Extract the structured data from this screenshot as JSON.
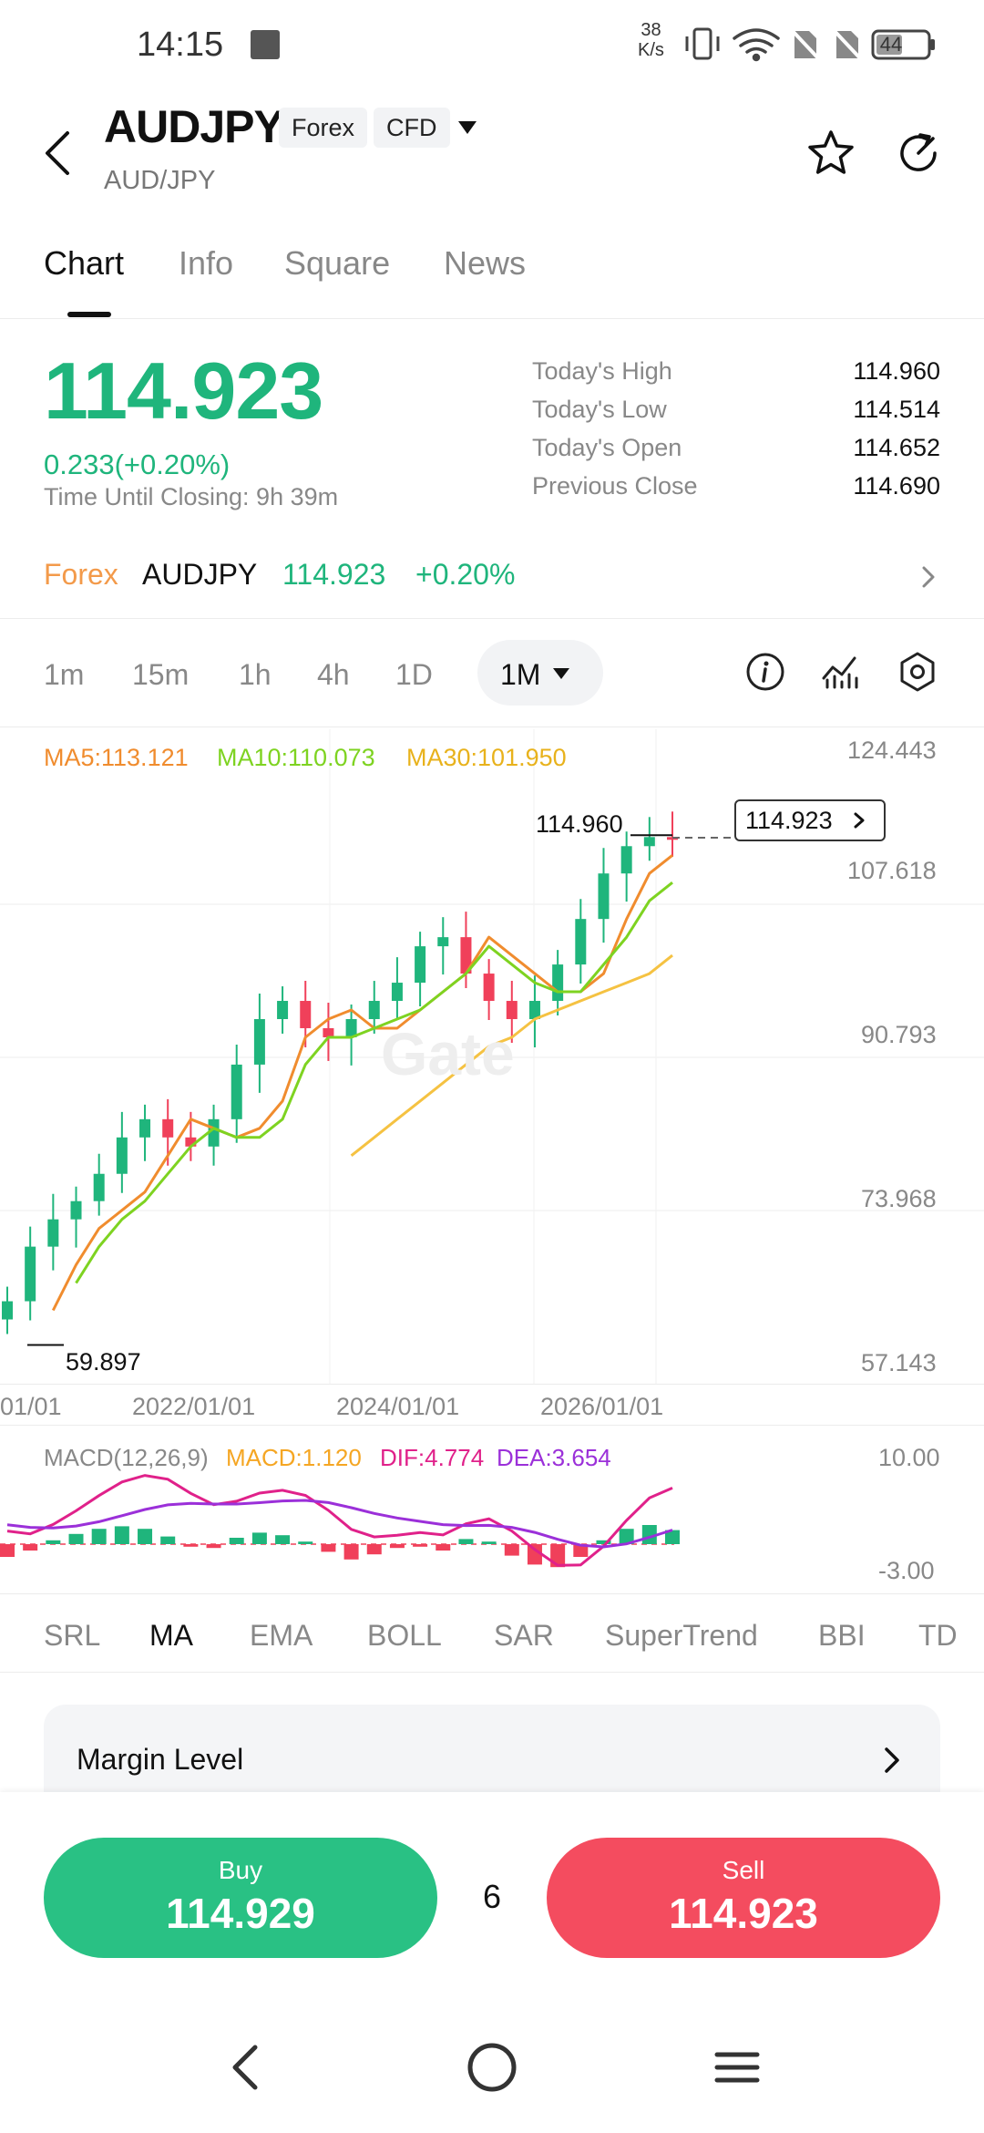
{
  "status_bar": {
    "time": "14:15",
    "net_speed_value": "38",
    "net_speed_unit": "K/s",
    "battery": "44"
  },
  "header": {
    "title": "AUDJPY",
    "tags": [
      "Forex",
      "CFD"
    ],
    "subtitle": "AUD/JPY"
  },
  "tabs": [
    {
      "label": "Chart",
      "active": true
    },
    {
      "label": "Info",
      "active": false
    },
    {
      "label": "Square",
      "active": false
    },
    {
      "label": "News",
      "active": false
    }
  ],
  "quote": {
    "price": "114.923",
    "change": "0.233(+0.20%)",
    "closing_text": "Time Until Closing: 9h 39m",
    "stats": [
      {
        "label": "Today's High",
        "value": "114.960"
      },
      {
        "label": "Today's Low",
        "value": "114.514"
      },
      {
        "label": "Today's Open",
        "value": "114.652"
      },
      {
        "label": "Previous Close",
        "value": "114.690"
      }
    ]
  },
  "market_line": {
    "category": "Forex",
    "symbol": "AUDJPY",
    "price": "114.923",
    "change_pct": "+0.20%"
  },
  "intervals": [
    "1m",
    "15m",
    "1h",
    "4h",
    "1D"
  ],
  "active_interval": "1M",
  "chart_legend": {
    "ma5": "MA5:113.121",
    "ma10": "MA10:110.073",
    "ma30": "MA30:101.950"
  },
  "chart_annotations": {
    "high_label": "114.960",
    "low_label": "59.897",
    "current_price": "114.923",
    "watermark": "Gate"
  },
  "chart_data": {
    "type": "line",
    "title": "",
    "y_axis_ticks": [
      "124.443",
      "107.618",
      "90.793",
      "73.968",
      "57.143"
    ],
    "x_axis_ticks": [
      "01/01",
      "2022/01/01",
      "2024/01/01",
      "2026/01/01"
    ],
    "ylim": [
      57.143,
      124.443
    ],
    "series": [
      {
        "name": "MA5",
        "color": "#f08c2e",
        "values": [
          63,
          68,
          72,
          74,
          76,
          80,
          84,
          83,
          82,
          83,
          86,
          93,
          95,
          96,
          94,
          94,
          96,
          98,
          100,
          104,
          102,
          100,
          98,
          98,
          100,
          106,
          111,
          113
        ]
      },
      {
        "name": "MA10",
        "color": "#7ed321",
        "values": [
          66,
          70,
          73,
          75,
          78,
          81,
          83,
          82,
          82,
          84,
          90,
          93,
          93,
          94,
          95,
          96,
          98,
          100,
          103,
          101,
          99,
          98,
          98,
          101,
          104,
          108,
          110
        ]
      },
      {
        "name": "MA30",
        "color": "#f5c242",
        "values": [
          80,
          82,
          84,
          86,
          88,
          90,
          92,
          93,
          95,
          96,
          97,
          98,
          99,
          100,
          102
        ]
      }
    ],
    "close_prices": [
      64,
      70,
      73,
      75,
      78,
      82,
      84,
      82,
      81,
      84,
      90,
      95,
      97,
      94,
      93,
      95,
      97,
      99,
      103,
      104,
      100,
      97,
      95,
      97,
      101,
      106,
      111,
      114,
      115,
      114.923
    ]
  },
  "macd": {
    "title": "MACD(12,26,9)",
    "macd": "MACD:1.120",
    "dif": "DIF:4.774",
    "dea": "DEA:3.654",
    "y_ticks": [
      "10.00",
      "-3.00"
    ],
    "histogram": [
      -1,
      -0.5,
      0.3,
      0.8,
      1.2,
      1.4,
      1.2,
      0.6,
      -0.2,
      -0.3,
      0.5,
      0.9,
      0.7,
      0.2,
      -0.6,
      -1.2,
      -0.8,
      -0.3,
      -0.2,
      -0.5,
      0.4,
      0.2,
      -0.9,
      -1.6,
      -1.8,
      -1.0,
      0.3,
      1.2,
      1.5,
      1.1
    ]
  },
  "indicators": [
    "SRL",
    "MA",
    "EMA",
    "BOLL",
    "SAR",
    "SuperTrend",
    "BBI",
    "TD"
  ],
  "active_indicator": "MA",
  "margin_card": {
    "label": "Margin Level"
  },
  "trade": {
    "buy_label": "Buy",
    "buy_price": "114.929",
    "sell_label": "Sell",
    "sell_price": "114.923",
    "spread": "6"
  },
  "colors": {
    "up": "#1fb57c",
    "down": "#f0405a",
    "forex_tag": "#f39a4a"
  }
}
